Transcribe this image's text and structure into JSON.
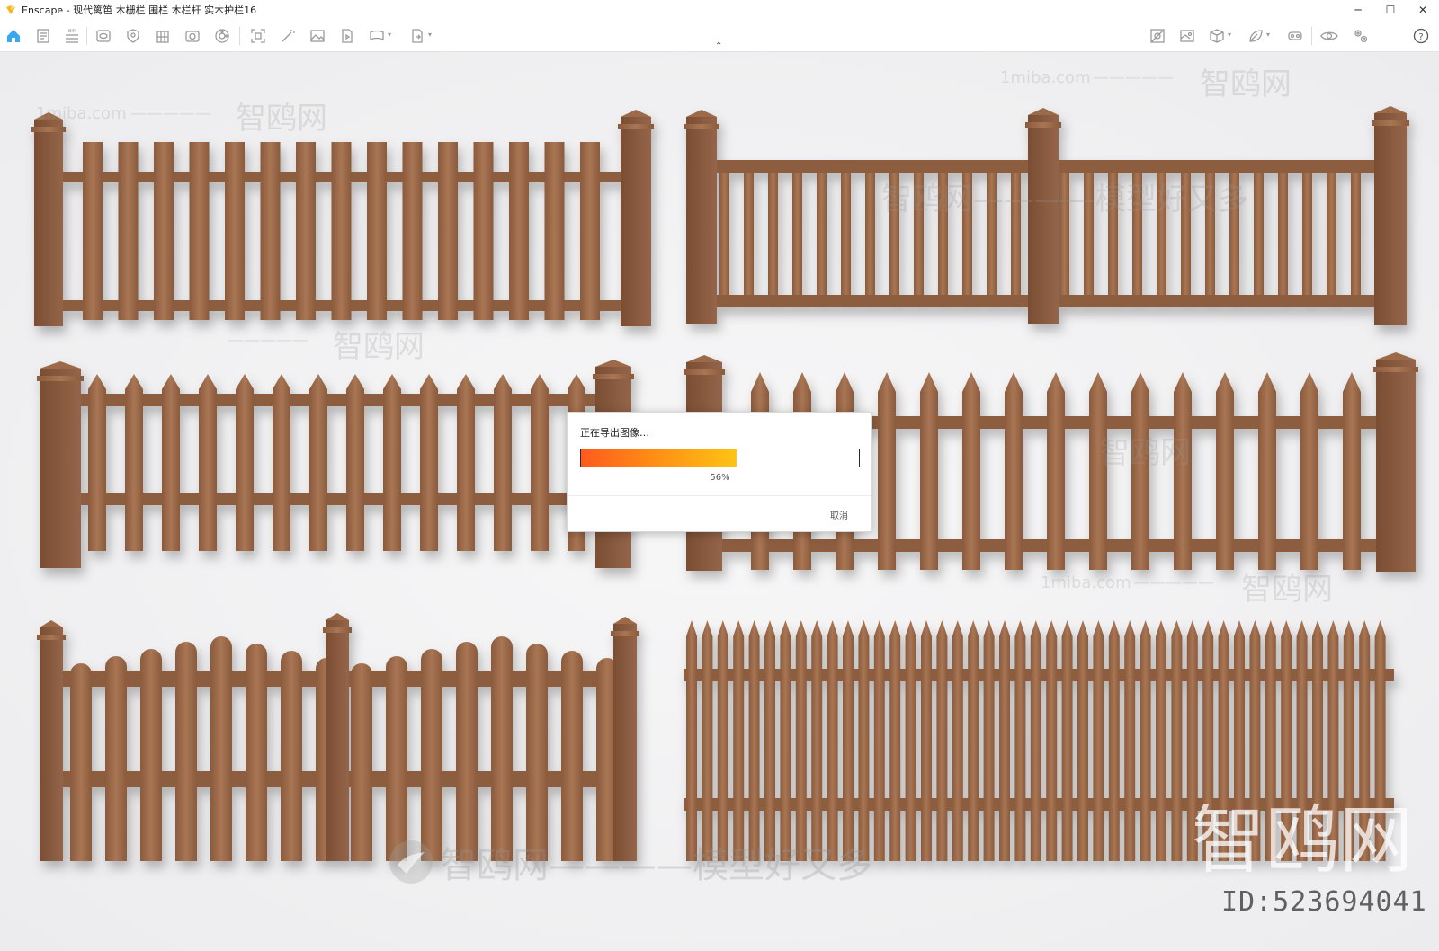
{
  "window": {
    "title": "Enscape - 现代篱笆 木栅栏 围栏 木栏杆 实木护栏16",
    "controls": {
      "minimize": "─",
      "maximize": "☐",
      "close": "✕"
    }
  },
  "toolbar": {
    "left_icons": [
      "home-icon",
      "document-icon",
      "bim-icon",
      "eye-icon",
      "shield-icon",
      "building-icon",
      "camera-icon",
      "palette-icon",
      "frame-icon",
      "wand-icon",
      "image-icon",
      "video-icon",
      "panorama-icon",
      "export-icon"
    ],
    "right_icons": [
      "render-settings-icon",
      "picture-icon",
      "cube-icon",
      "leaf-icon",
      "vr-headset-icon",
      "visibility-icon",
      "settings-icon",
      "help-icon"
    ],
    "collapse_glyph": "⌃",
    "accent_color": "#3aa7f0"
  },
  "export_dialog": {
    "title": "正在导出图像…",
    "progress_percent": 56,
    "progress_label": "56%",
    "cancel_label": "取消"
  },
  "viewport": {
    "wood_color": "#9c6b4a",
    "watermarks": {
      "site": "1miba.com",
      "brand": "智鸥网",
      "dashes": "—————",
      "tagline": "智鸥网————模型好又多",
      "id_text": "ID:523694041"
    }
  }
}
